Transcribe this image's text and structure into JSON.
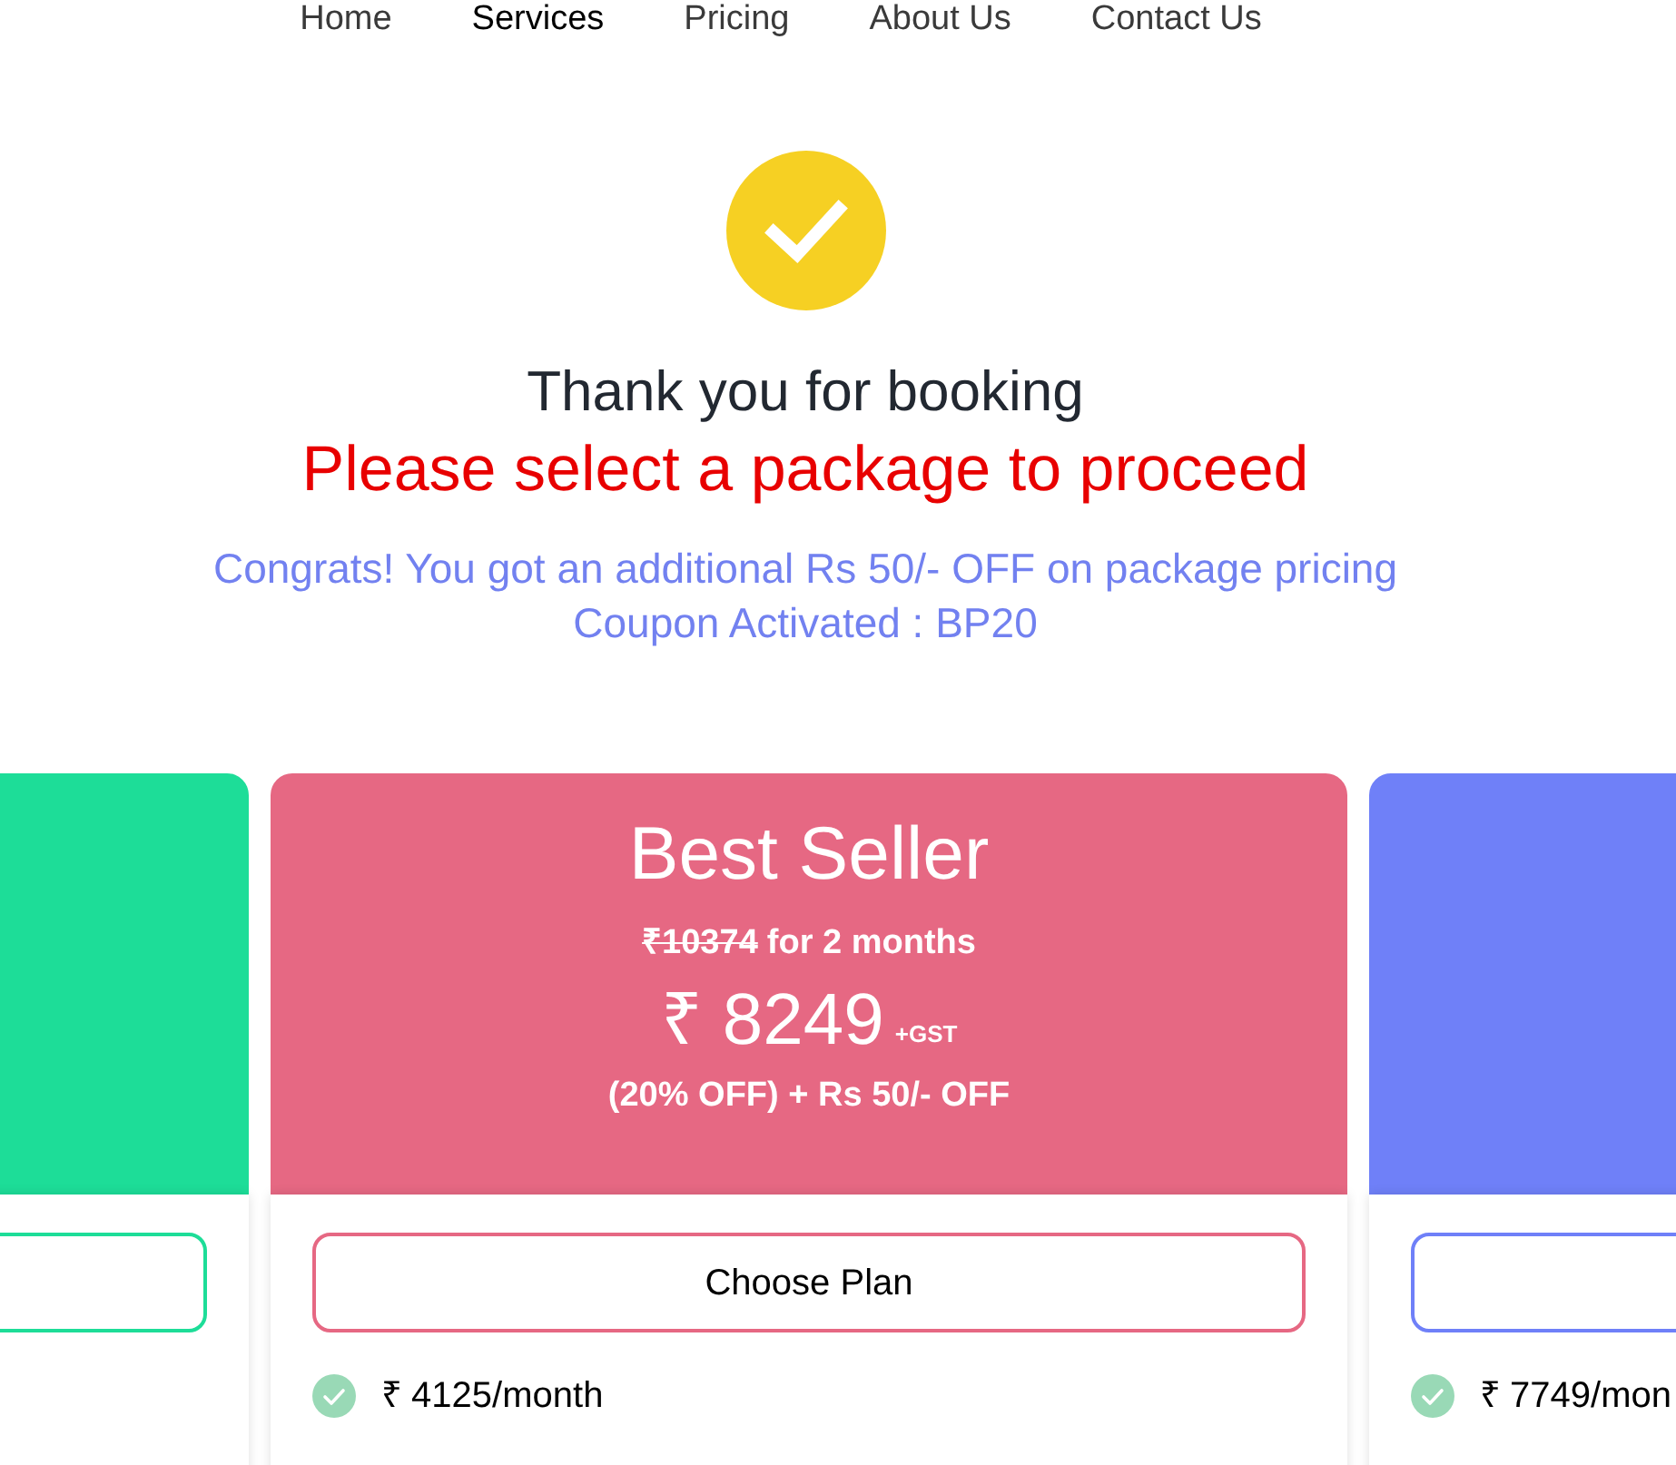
{
  "nav": [
    {
      "label": "Home",
      "selected": false
    },
    {
      "label": "Services",
      "selected": true
    },
    {
      "label": "Pricing",
      "selected": false
    },
    {
      "label": "About Us",
      "selected": false
    },
    {
      "label": "Contact Us",
      "selected": false
    }
  ],
  "confirmation": {
    "title": "Thank you for booking",
    "prompt": "Please select a package to proceed",
    "offer_lines": [
      "Congrats! You got an additional Rs 50/- OFF on package pricing",
      "Coupon Activated : BP20"
    ]
  },
  "plans": [
    {
      "color": "#1ddd98"
    },
    {
      "color": "#e66883",
      "title": "Best Seller",
      "original_price": "₹10374",
      "period": "for 2 months",
      "price": "₹ 8249",
      "tax_note": "+GST",
      "discount": "(20% OFF) + Rs 50/- OFF",
      "button": "Choose Plan",
      "features": [
        "₹ 4125/month"
      ]
    },
    {
      "color": "#6f80f8",
      "features": [
        "₹ 7749/mon"
      ]
    }
  ]
}
